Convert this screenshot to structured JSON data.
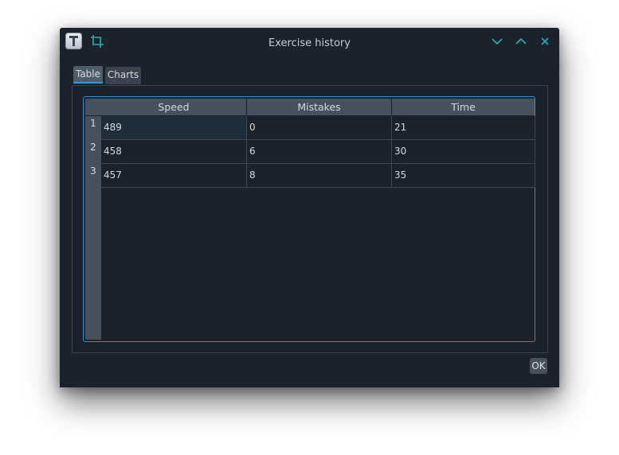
{
  "window": {
    "title": "Exercise history"
  },
  "icons": {
    "app": "typing-app-icon",
    "crop": "crop-icon",
    "minimize": "chevron-down-icon",
    "maximize": "chevron-up-icon",
    "close": "close-icon"
  },
  "colors": {
    "accent": "#2f9be0",
    "window_controls": "#1ab3b3",
    "background": "#1b222c"
  },
  "tabs": [
    {
      "label": "Table",
      "active": true
    },
    {
      "label": "Charts",
      "active": false
    }
  ],
  "table": {
    "columns": [
      "Speed",
      "Mistakes",
      "Time"
    ],
    "row_headers": [
      "1",
      "2",
      "3"
    ],
    "rows": [
      [
        "489",
        "0",
        "21"
      ],
      [
        "458",
        "6",
        "30"
      ],
      [
        "457",
        "8",
        "35"
      ]
    ],
    "selected_cell": "row 1, Speed"
  },
  "buttons": {
    "ok_label": "OK"
  }
}
